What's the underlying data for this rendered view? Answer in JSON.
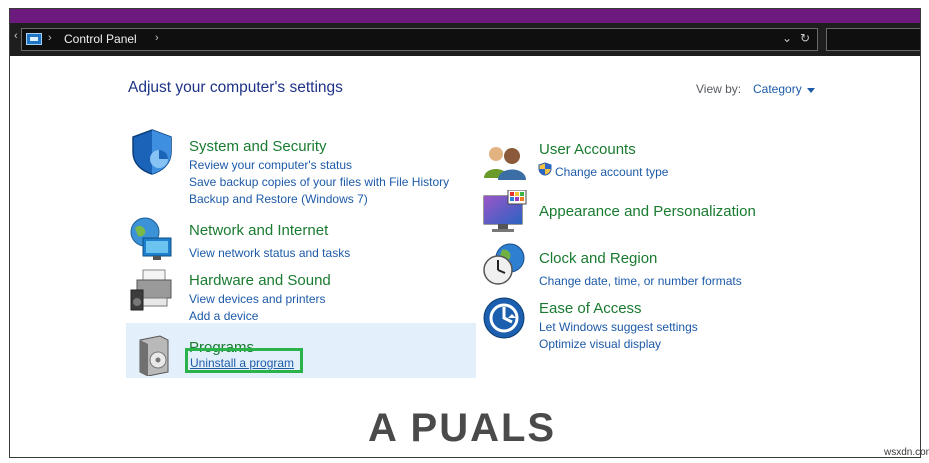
{
  "address_bar": {
    "breadcrumb": "Control Panel",
    "sep": "›",
    "nav_chevron": "‹",
    "dropdown_glyph": "⌄",
    "refresh_glyph": "↻"
  },
  "main": {
    "heading": "Adjust your computer's settings",
    "view_by": {
      "label": "View by:",
      "value": "Category"
    }
  },
  "categories": {
    "system_security": {
      "title": "System and Security",
      "links": [
        "Review your computer's status",
        "Save backup copies of your files with File History",
        "Backup and Restore (Windows 7)"
      ]
    },
    "network_internet": {
      "title": "Network and Internet",
      "links": [
        "View network status and tasks"
      ]
    },
    "hardware_sound": {
      "title": "Hardware and Sound",
      "links": [
        "View devices and printers",
        "Add a device"
      ]
    },
    "programs": {
      "title": "Programs",
      "links": [
        "Uninstall a program"
      ]
    },
    "user_accounts": {
      "title": "User Accounts",
      "links": [
        "Change account type"
      ]
    },
    "appearance": {
      "title": "Appearance and Personalization",
      "links": []
    },
    "clock_region": {
      "title": "Clock and Region",
      "links": [
        "Change date, time, or number formats"
      ]
    },
    "ease_access": {
      "title": "Ease of Access",
      "links": [
        "Let Windows suggest settings",
        "Optimize visual display"
      ]
    }
  },
  "watermark": {
    "brand": "A PUALS",
    "site": "wsxdn.com"
  },
  "colors": {
    "title_bar": "#6d1a7e",
    "address_bar": "#1e1e1e",
    "category_title": "#197b30",
    "link": "#1d5aa8",
    "heading": "#1e3287",
    "highlight": "#e3f0fb",
    "annotation_box": "#29b34a"
  }
}
